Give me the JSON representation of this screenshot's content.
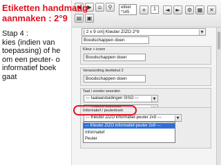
{
  "slide": {
    "title_line1": "Etiketten handmatig",
    "title_line2": "aanmaken : 2°9",
    "step_lines": [
      "Stap 4 :",
      "kies (indien van",
      "toepassing) of he",
      "om een peuter- o",
      "informatief boek",
      "gaat"
    ]
  },
  "toolbar": {
    "label_field": "etiket\n*145",
    "count": "1",
    "search_icon": "search-icon",
    "print_icon": "print-icon"
  },
  "recipe_select": "[ 2 x 9 cm] Kleuter ZIZO 2*9",
  "top_field": "Boodschappen doen",
  "panels": {
    "kleur": {
      "label": "Kleur + icoon",
      "value": "Boodschappen doen"
    },
    "verwoording": {
      "label": "Verwoording deeltekst 2",
      "value": "Boodschappen doen"
    },
    "taal": {
      "label": "Taal / zonder woorden",
      "select1": "--- taalaanduidingen SISO ---",
      "select2": "--- Zonder woorden ---"
    },
    "informatief": {
      "label": "Informatief / peuterboek",
      "selected": "--- Kleuter ZIZO informatief-peuter 2x9 ---",
      "options": [
        "--- Kleuter ZIZO informatief-peuter 2x9 ---",
        "Informatief",
        "Peuter"
      ]
    }
  },
  "colors": {
    "title_red": "#e0101e",
    "highlight_red": "#e01020",
    "selected_blue": "#2f6fd6"
  }
}
